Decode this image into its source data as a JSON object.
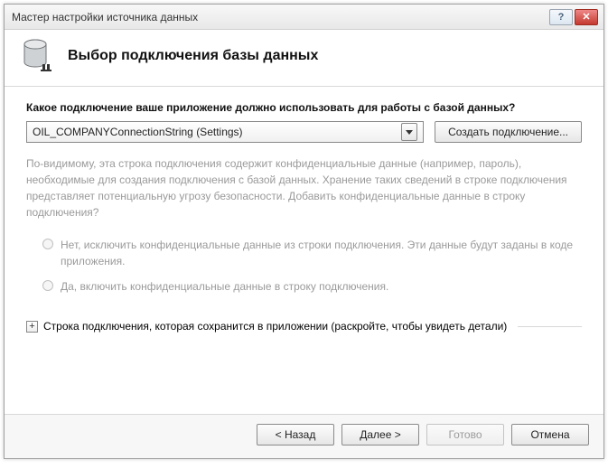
{
  "window": {
    "title": "Мастер настройки источника данных"
  },
  "header": {
    "title": "Выбор подключения базы данных"
  },
  "content": {
    "question": "Какое подключение ваше приложение должно использовать для работы с базой данных?",
    "connection_value": "OIL_COMPANYConnectionString (Settings)",
    "new_connection_btn": "Создать подключение...",
    "info_paragraph": "По-видимому, эта строка подключения содержит конфиденциальные данные (например, пароль), необходимые для создания подключения с базой данных. Хранение таких сведений в строке подключения представляет потенциальную угрозу безопасности. Добавить конфиденциальные данные в строку подключения?",
    "radio_no": "Нет, исключить конфиденциальные данные из строки подключения. Эти данные будут заданы в коде приложения.",
    "radio_yes": "Да, включить конфиденциальные данные в строку подключения.",
    "expander_label": "Строка подключения, которая сохранится в приложении (раскройте, чтобы увидеть детали)"
  },
  "footer": {
    "prev": "< Назад",
    "next": "Далее >",
    "finish": "Готово",
    "cancel": "Отмена"
  }
}
